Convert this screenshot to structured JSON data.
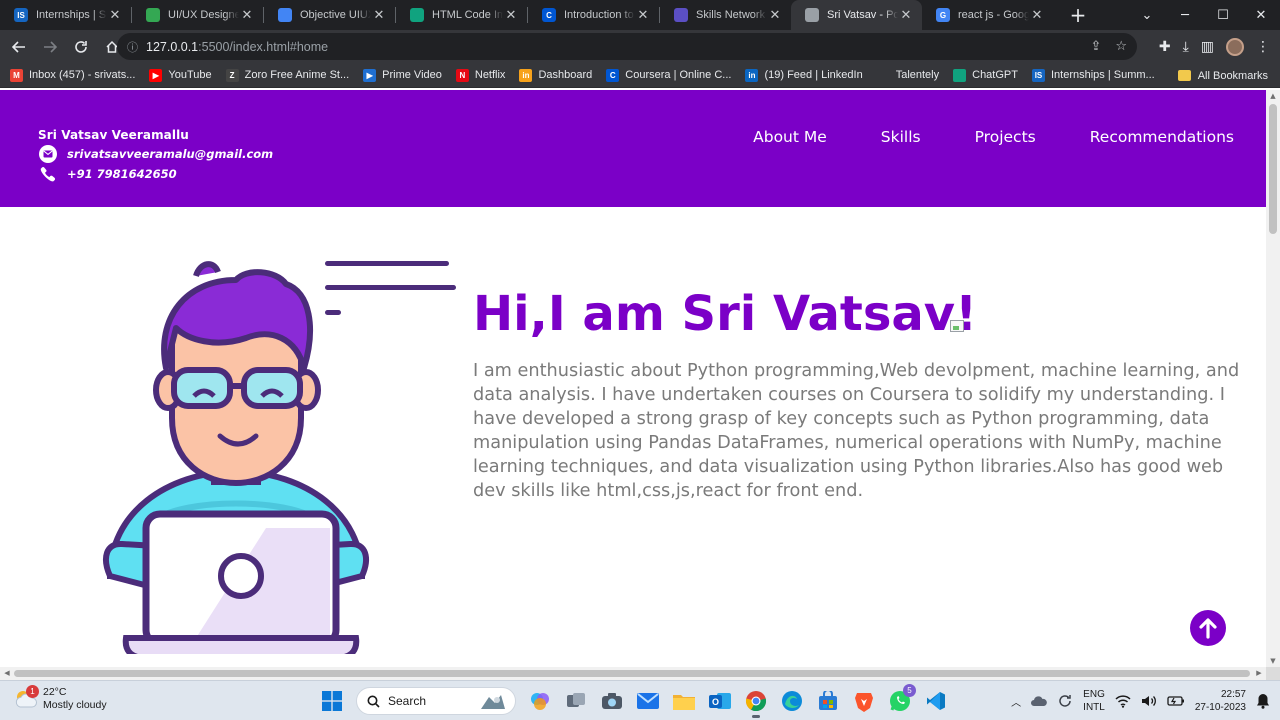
{
  "browser": {
    "tabs": [
      {
        "title": "Internships | Sum",
        "fav_color": "#1565c0",
        "fav_text": "IS",
        "active": false
      },
      {
        "title": "UI/UX Designer T",
        "fav_color": "#34a853",
        "fav_text": "",
        "active": false
      },
      {
        "title": "Objective UIUX D",
        "fav_color": "#4285f4",
        "fav_text": "",
        "active": false
      },
      {
        "title": "HTML Code Imp",
        "fav_color": "#10a37f",
        "fav_text": "",
        "active": false
      },
      {
        "title": "Introduction to W",
        "fav_color": "#0056d2",
        "fav_text": "C",
        "active": false
      },
      {
        "title": "Skills Network Ed",
        "fav_color": "#5b4fc4",
        "fav_text": "",
        "active": false
      },
      {
        "title": "Sri Vatsav - Portf",
        "fav_color": "#9aa0a6",
        "fav_text": "",
        "active": true
      },
      {
        "title": "react js - Google",
        "fav_color": "#4285f4",
        "fav_text": "G",
        "active": false
      }
    ],
    "url_host": "127.0.0.1",
    "url_rest": ":5500/index.html#home",
    "bookmarks": [
      {
        "label": "Inbox (457) - srivats...",
        "fav_color": "#ea4335",
        "fav_text": "M"
      },
      {
        "label": "YouTube",
        "fav_color": "#ff0000",
        "fav_text": "▶"
      },
      {
        "label": "Zoro Free Anime St...",
        "fav_color": "#444444",
        "fav_text": "Z"
      },
      {
        "label": "Prime Video",
        "fav_color": "#1f6fd1",
        "fav_text": "▶"
      },
      {
        "label": "Netflix",
        "fav_color": "#e50914",
        "fav_text": "N"
      },
      {
        "label": "Dashboard",
        "fav_color": "#f7a21b",
        "fav_text": "in"
      },
      {
        "label": "Coursera | Online C...",
        "fav_color": "#0056d2",
        "fav_text": "C"
      },
      {
        "label": "(19) Feed | LinkedIn",
        "fav_color": "#0a66c2",
        "fav_text": "in"
      },
      {
        "label": "Talentely",
        "fav_color": "#35363a",
        "fav_text": ""
      },
      {
        "label": "ChatGPT",
        "fav_color": "#10a37f",
        "fav_text": ""
      },
      {
        "label": "Internships | Summ...",
        "fav_color": "#1565c0",
        "fav_text": "IS"
      }
    ],
    "all_bookmarks": "All Bookmarks"
  },
  "page": {
    "contact": {
      "name": "Sri Vatsav Veeramallu",
      "email": "srivatsavveeramalu@gmail.com",
      "phone": "+91 7981642650"
    },
    "nav": [
      "About Me",
      "Skills",
      "Projects",
      "Recommendations"
    ],
    "hero": {
      "title": "Hi,I am Sri Vatsav!",
      "description": "I am enthusiastic about Python programming,Web devolpment, machine learning, and data analysis. I have undertaken courses on Coursera to solidify my understanding. I have developed a strong grasp of key concepts such as Python programming, data manipulation using Pandas DataFrames, numerical operations with NumPy, machine learning techniques, and data visualization using Python libraries.Also has good web dev skills like html,css,js,react for front end."
    },
    "colors": {
      "brand": "#7b00c7",
      "text": "#7a7a7a"
    }
  },
  "taskbar": {
    "weather_temp": "22°C",
    "weather_desc": "Mostly cloudy",
    "weather_badge": "1",
    "search_label": "Search",
    "whatsapp_badge": "5",
    "lang_top": "ENG",
    "lang_bottom": "INTL",
    "time": "22:57",
    "date": "27-10-2023"
  }
}
